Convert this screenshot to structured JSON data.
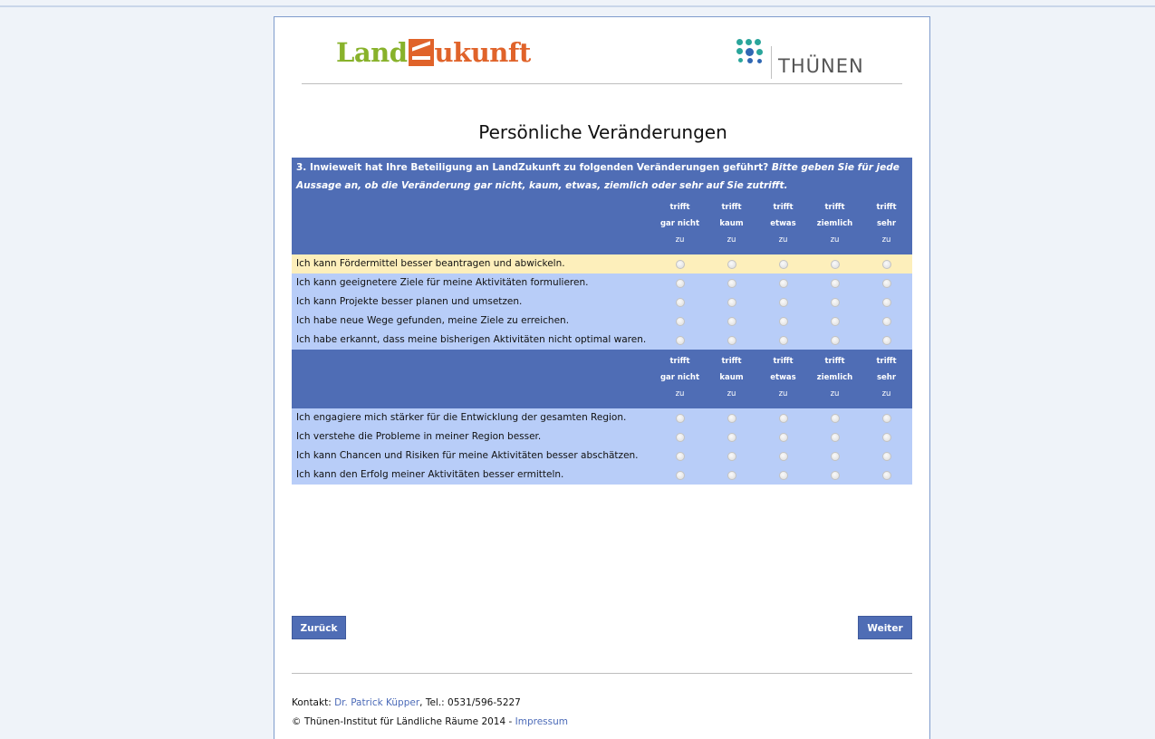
{
  "header": {
    "logo_land": "Land",
    "logo_ukunft": "ukunft",
    "thuenen_text": "THÜNEN"
  },
  "page_title": "Persönliche Veränderungen",
  "question": {
    "text": "3. Inwieweit hat Ihre Beteiligung an LandZukunft zu folgenden Veränderungen geführt?",
    "instruction": "Bitte geben Sie für jede Aussage an, ob die Veränderung gar nicht, kaum, etwas, ziemlich oder sehr auf Sie zutrifft."
  },
  "columns": [
    {
      "l1": "trifft",
      "l2": "gar nicht",
      "l3": "zu"
    },
    {
      "l1": "trifft",
      "l2": "kaum",
      "l3": "zu"
    },
    {
      "l1": "trifft",
      "l2": "etwas",
      "l3": "zu"
    },
    {
      "l1": "trifft",
      "l2": "ziemlich",
      "l3": "zu"
    },
    {
      "l1": "trifft",
      "l2": "sehr",
      "l3": "zu"
    }
  ],
  "rows_group1": [
    "Ich kann Fördermittel besser beantragen und abwickeln.",
    "Ich kann geeignetere Ziele für meine Aktivitäten formulieren.",
    "Ich kann Projekte besser planen und umsetzen.",
    "Ich habe neue Wege gefunden, meine Ziele zu erreichen.",
    "Ich habe erkannt, dass meine bisherigen Aktivitäten nicht optimal waren."
  ],
  "rows_group2": [
    "Ich engagiere mich stärker für die Entwicklung der gesamten Region.",
    "Ich verstehe die Probleme in meiner Region besser.",
    "Ich kann Chancen und Risiken für meine Aktivitäten besser abschätzen.",
    "Ich kann den Erfolg meiner Aktivitäten besser ermitteln."
  ],
  "buttons": {
    "back": "Zurück",
    "next": "Weiter"
  },
  "footer": {
    "contact_label": "Kontakt: ",
    "contact_name": "Dr. Patrick Küpper",
    "contact_phone": ", Tel.: 0531/596-5227",
    "copyright": "© Thünen-Institut für Ländliche Räume 2014 - ",
    "impressum": "Impressum"
  },
  "colors": {
    "header_blue": "#4f6db5",
    "row_blue": "#b8cdf8",
    "row_highlight": "#fdefbb",
    "logo_green": "#88b22b",
    "logo_orange": "#e0632a"
  }
}
